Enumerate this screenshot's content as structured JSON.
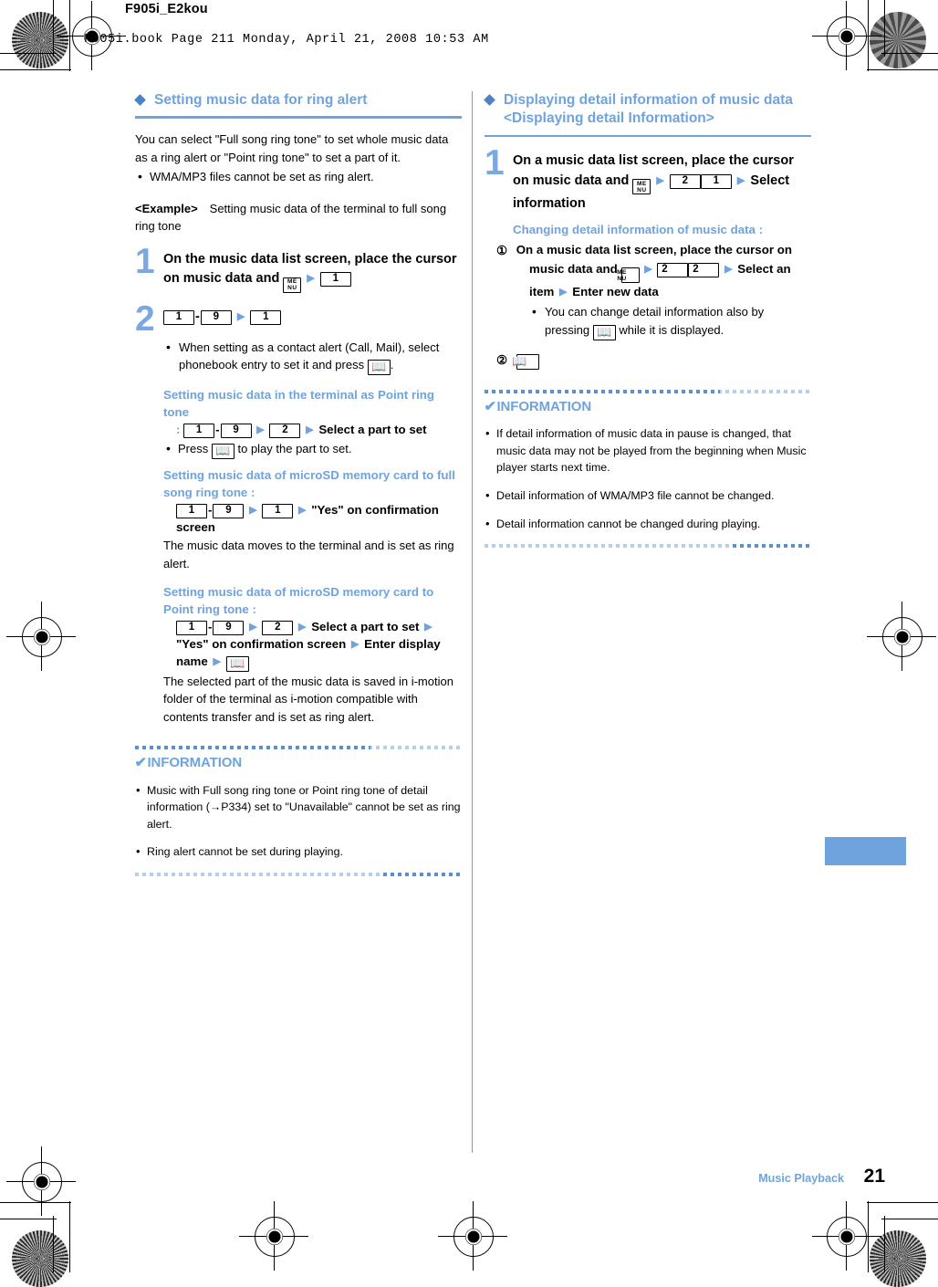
{
  "header": {
    "doc_code": "F905i_E2kou",
    "book_line": "F905i.book  Page 211  Monday, April 21, 2008  10:53 AM"
  },
  "footer": {
    "chapter": "Music Playback",
    "page_number": "21"
  },
  "colors": {
    "heading_blue": "#6fa3dd",
    "diamond_blue": "#4b83c6",
    "step_number_blue": "#7aa9e0",
    "rule_blue": "#6fa3dd",
    "tab_blue": "#6fa3dd",
    "text_black": "#000000"
  },
  "icons": {
    "diamond": "diamond-bullet-icon",
    "menu_key": "menu-key-icon",
    "book_key": "book-key-icon",
    "arrow": "right-triangle-arrow-icon",
    "check": "check-mark-icon"
  },
  "keys": {
    "menu_top": "ME",
    "menu_bottom": "NU",
    "one": "1",
    "two": "2",
    "nine": "9",
    "book": "☐",
    "dash": "-",
    "arrow": "▶"
  },
  "left_column": {
    "heading": "Setting music data for ring alert",
    "intro": "You can select \"Full song ring tone\" to set whole music data as a ring alert or \"Point ring tone\" to set a part of it.",
    "intro_bullet": "WMA/MP3 files cannot be set as ring alert.",
    "example_label": "<Example>",
    "example_text": "Setting music data of the terminal to full song ring tone",
    "step1": {
      "number": "1",
      "text_a": "On the music data list screen, place the cursor on music data and"
    },
    "step2": {
      "number": "2",
      "bullet": "When setting as a contact alert (Call, Mail), select phonebook entry to set it and press"
    },
    "sub_point_terminal": {
      "title": "Setting music data in the terminal as Point ring tone",
      "tail": "Select a part to set",
      "bullet_pre": "Press",
      "bullet_post": "to play the part to set."
    },
    "sub_microsd_full": {
      "title": "Setting music data of microSD memory card to full song ring tone :",
      "tail": "\"Yes\" on confirmation screen",
      "result": "The music data moves to the terminal and is set as ring alert."
    },
    "sub_microsd_point": {
      "title": "Setting music data of microSD memory card to Point ring tone :",
      "tail_a": "Select a part to set",
      "tail_b": "\"Yes\" on confirmation screen",
      "tail_c": "Enter display name",
      "result": "The selected part of the music data is saved in i-motion folder of the terminal as i-motion compatible with contents transfer and is set as ring alert."
    },
    "information": {
      "title": "INFORMATION",
      "items": [
        "Music with Full song ring tone or Point ring tone of detail information (→P334) set to \"Unavailable\" cannot be set as ring alert.",
        "Ring alert cannot be set during playing."
      ]
    }
  },
  "right_column": {
    "heading_line1": "Displaying detail information of music data",
    "heading_line2": "<Displaying detail Information>",
    "step1": {
      "number": "1",
      "text_a": "On a music data list screen, place the cursor on music data and",
      "text_b": "Select information"
    },
    "changing": {
      "title": "Changing detail information of music data :",
      "item1_marker": "①",
      "item1_text_a": "On a music data list screen, place the cursor on music data and",
      "item1_text_b": "Select an item",
      "item1_text_c": "Enter new data",
      "item1_bullet_a": "You can change detail information also by pressing",
      "item1_bullet_b": "while it is displayed.",
      "item2_marker": "②"
    },
    "information": {
      "title": "INFORMATION",
      "items": [
        "If detail information of music data in pause is changed, that music data may not be played from the beginning when Music player starts next time.",
        "Detail information of WMA/MP3 file cannot be changed.",
        "Detail information cannot be changed during playing."
      ]
    }
  }
}
